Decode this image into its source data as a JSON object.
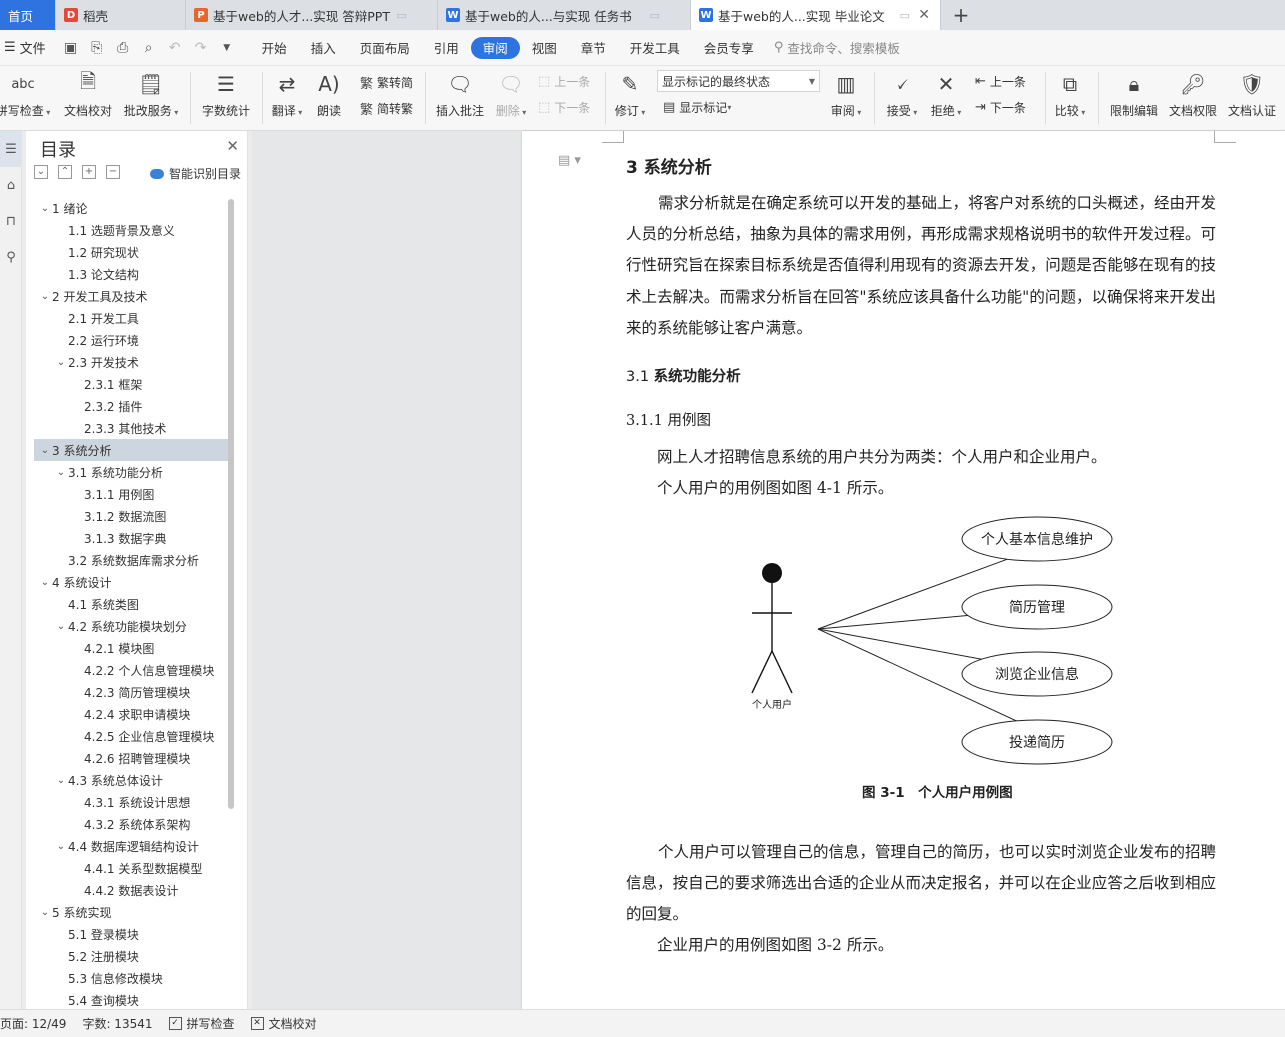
{
  "tabs": [
    {
      "label": "首页",
      "icon": "home-tab"
    },
    {
      "label": "稻壳",
      "icon": "docer-icon"
    },
    {
      "label": "基于web的人才...实现 答辩PPT",
      "icon": "ppt-icon"
    },
    {
      "label": "基于web的人...与实现 任务书",
      "icon": "word-icon"
    },
    {
      "label": "基于web的人...实现 毕业论文",
      "icon": "word-icon"
    }
  ],
  "menu": {
    "file": "文件",
    "items": [
      "开始",
      "插入",
      "页面布局",
      "引用",
      "审阅",
      "视图",
      "章节",
      "开发工具",
      "会员专享"
    ],
    "active": "审阅",
    "search_placeholder": "查找命令、搜索模板"
  },
  "ribbon": {
    "spell": "拼写检查",
    "proofread": "文档校对",
    "revise_service": "批改服务",
    "word_count": "字数统计",
    "translate": "翻译",
    "read_aloud": "朗读",
    "to_traditional": "繁转简",
    "to_simplified": "简转繁",
    "insert_comment": "插入批注",
    "delete": "删除",
    "prev_comment": "上一条",
    "next_comment": "下一条",
    "track": "修订",
    "markup_state": "显示标记的最终状态",
    "show_markup": "显示标记",
    "review": "审阅",
    "accept": "接受",
    "reject": "拒绝",
    "prev_change": "上一条",
    "next_change": "下一条",
    "compare": "比较",
    "restrict": "限制编辑",
    "permission": "文档权限",
    "certify": "文档认证"
  },
  "nav": {
    "title": "目录",
    "smart": "智能识别目录",
    "items": [
      {
        "text": "1  绪论",
        "level": 1,
        "chev": true
      },
      {
        "text": "1.1  选题背景及意义",
        "level": 2,
        "chev": false
      },
      {
        "text": "1.2  研究现状",
        "level": 2,
        "chev": false
      },
      {
        "text": "1.3  论文结构",
        "level": 2,
        "chev": false
      },
      {
        "text": "2  开发工具及技术",
        "level": 1,
        "chev": true
      },
      {
        "text": "2.1 开发工具",
        "level": 2,
        "chev": false
      },
      {
        "text": "2.2 运行环境",
        "level": 2,
        "chev": false
      },
      {
        "text": "2.3  开发技术",
        "level": 2,
        "chev": true
      },
      {
        "text": "2.3.1  框架",
        "level": 3,
        "chev": false
      },
      {
        "text": "2.3.2  插件",
        "level": 3,
        "chev": false
      },
      {
        "text": "2.3.3  其他技术",
        "level": 3,
        "chev": false
      },
      {
        "text": "3  系统分析",
        "level": 1,
        "chev": true,
        "selected": true
      },
      {
        "text": "3.1 系统功能分析",
        "level": 2,
        "chev": true
      },
      {
        "text": "3.1.1  用例图",
        "level": 3,
        "chev": false
      },
      {
        "text": "3.1.2  数据流图",
        "level": 3,
        "chev": false
      },
      {
        "text": "3.1.3  数据字典",
        "level": 3,
        "chev": false
      },
      {
        "text": "3.2  系统数据库需求分析",
        "level": 2,
        "chev": false
      },
      {
        "text": "4  系统设计",
        "level": 1,
        "chev": true
      },
      {
        "text": "4.1 系统类图",
        "level": 2,
        "chev": false
      },
      {
        "text": "4.2 系统功能模块划分",
        "level": 2,
        "chev": true
      },
      {
        "text": "4.2.1  模块图",
        "level": 3,
        "chev": false
      },
      {
        "text": "4.2.2  个人信息管理模块",
        "level": 3,
        "chev": false
      },
      {
        "text": "4.2.3  简历管理模块",
        "level": 3,
        "chev": false
      },
      {
        "text": "4.2.4  求职申请模块",
        "level": 3,
        "chev": false
      },
      {
        "text": "4.2.5  企业信息管理模块",
        "level": 3,
        "chev": false
      },
      {
        "text": "4.2.6  招聘管理模块",
        "level": 3,
        "chev": false
      },
      {
        "text": "4.3 系统总体设计",
        "level": 2,
        "chev": true
      },
      {
        "text": "4.3.1  系统设计思想",
        "level": 3,
        "chev": false
      },
      {
        "text": "4.3.2  系统体系架构",
        "level": 3,
        "chev": false
      },
      {
        "text": "4.4  数据库逻辑结构设计",
        "level": 2,
        "chev": true
      },
      {
        "text": "4.4.1  关系型数据模型",
        "level": 3,
        "chev": false
      },
      {
        "text": "4.4.2  数据表设计",
        "level": 3,
        "chev": false
      },
      {
        "text": "5  系统实现",
        "level": 1,
        "chev": true
      },
      {
        "text": "5.1  登录模块",
        "level": 2,
        "chev": false
      },
      {
        "text": "5.2  注册模块",
        "level": 2,
        "chev": false
      },
      {
        "text": "5.3  信息修改模块",
        "level": 2,
        "chev": false
      },
      {
        "text": "5.4  查询模块",
        "level": 2,
        "chev": false
      }
    ]
  },
  "doc": {
    "h1": "3  系统分析",
    "p1": "需求分析就是在确定系统可以开发的基础上，将客户对系统的口头概述，经由开发人员的分析总结，抽象为具体的需求用例，再形成需求规格说明书的软件开发过程。可行性研究旨在探索目标系统是否值得利用现有的资源去开发，问题是否能够在现有的技术上去解决。而需求分析旨在回答\"系统应该具备什么功能\"的问题，以确保将来开发出来的系统能够让客户满意。",
    "h2_num": "3.1 ",
    "h2_text": "系统功能分析",
    "h3": "3.1.1  用例图",
    "line1": "网上人才招聘信息系统的用户共分为两类：个人用户和企业用户。",
    "line2": "个人用户的用例图如图 4-1 所示。",
    "diagram": {
      "actor": "个人用户",
      "usecases": [
        "个人基本信息维护",
        "简历管理",
        "浏览企业信息",
        "投递简历"
      ]
    },
    "caption": "图 3-1　个人用户用例图",
    "p2": "个人用户可以管理自己的信息，管理自己的简历，也可以实时浏览企业发布的招聘信息，按自己的要求筛选出合适的企业从而决定报名，并可以在企业应答之后收到相应的回复。",
    "line3": "企业用户的用例图如图 3-2 所示。"
  },
  "status": {
    "page": "页面: 12/49",
    "words": "字数: 13541",
    "spell": "拼写检查",
    "proof": "文档校对"
  }
}
